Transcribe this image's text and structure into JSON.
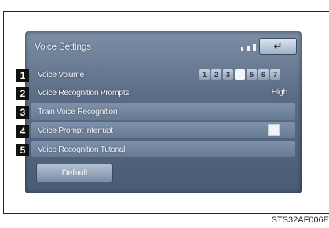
{
  "screen": {
    "title": "Voice Settings",
    "back_icon": "↵"
  },
  "rows": [
    {
      "label": "Voice Volume"
    },
    {
      "label": "Voice Recognition Prompts",
      "value": "High"
    },
    {
      "label": "Train Voice Recognition"
    },
    {
      "label": "Voice Prompt Interrupt",
      "checked": true
    },
    {
      "label": "Voice Recognition Tutorial"
    }
  ],
  "volume_levels": [
    "1",
    "2",
    "3",
    "4",
    "5",
    "6",
    "7"
  ],
  "volume_selected": "4",
  "default_button": "Default",
  "callouts": [
    "1",
    "2",
    "3",
    "4",
    "5"
  ],
  "reference_code": "STS32AF006E"
}
